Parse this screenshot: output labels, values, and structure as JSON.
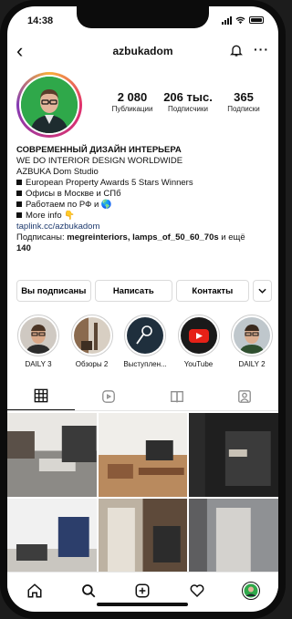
{
  "status_bar": {
    "time": "14:38"
  },
  "header": {
    "username": "azbukadom",
    "back_icon": "chevron-left-icon",
    "bell_icon": "bell-icon",
    "more_icon": "more-horizontal-icon"
  },
  "stats": [
    {
      "value": "2 080",
      "label": "Публикации"
    },
    {
      "value": "206 тыс.",
      "label": "Подписчики"
    },
    {
      "value": "365",
      "label": "Подписки"
    }
  ],
  "bio": {
    "name": "СОВРЕМЕННЫЙ ДИЗАЙН ИНТЕРЬЕРА",
    "line1": "WE DO INTERIOR DESIGN WORLDWIDE",
    "line2": "AZBUKA Dom Studio",
    "items": [
      "European Property Awards 5 Stars Winners",
      "Офисы в Москве и СПб",
      "Работаем по РФ и 🌎",
      "More info 👇"
    ],
    "link": "taplink.cc/azbukadom",
    "followed_prefix": "Подписаны: ",
    "followed_names": "megreinteriors, lamps_of_50_60_70s",
    "followed_suffix": " и ещё",
    "followed_count": "140"
  },
  "buttons": {
    "following": "Вы подписаны",
    "message": "Написать",
    "contacts": "Контакты",
    "dropdown_icon": "chevron-down-icon"
  },
  "highlights": [
    {
      "label": "DAILY 3"
    },
    {
      "label": "Обзоры 2"
    },
    {
      "label": "Выступлен..."
    },
    {
      "label": "YouTube"
    },
    {
      "label": "DAILY 2"
    }
  ],
  "tabs": [
    "grid-icon",
    "reels-icon",
    "guide-icon",
    "tagged-icon"
  ],
  "nav": [
    "home-icon",
    "search-icon",
    "add-post-icon",
    "heart-icon",
    "profile-avatar"
  ]
}
